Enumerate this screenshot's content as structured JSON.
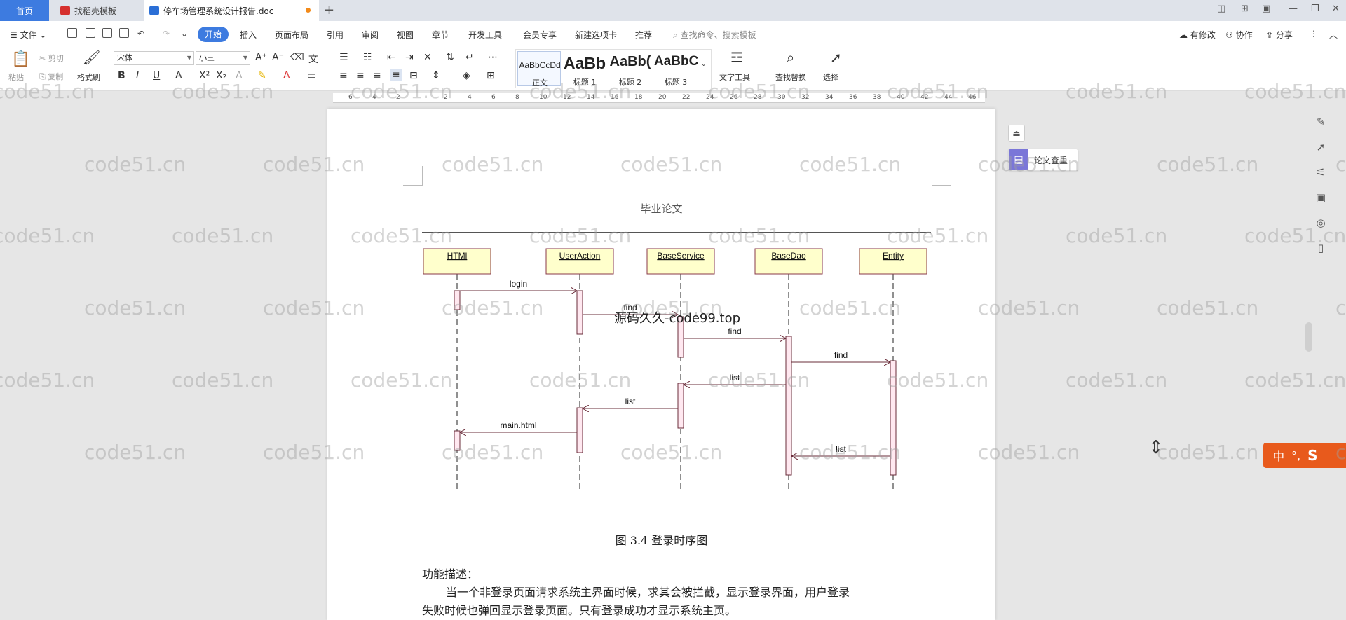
{
  "tabs": {
    "home": "首页",
    "doc1": "找稻壳模板",
    "doc2": "停车场管理系统设计报告.doc"
  },
  "menu": {
    "file": "文件",
    "start": "开始",
    "items": [
      "插入",
      "页面布局",
      "引用",
      "审阅",
      "视图",
      "章节",
      "开发工具",
      "会员专享",
      "新建选项卡",
      "推荐"
    ],
    "search_placeholder": "查找命令、搜索模板",
    "right": [
      "有修改",
      "协作",
      "分享"
    ]
  },
  "ribbon": {
    "paste": "粘贴",
    "cut": "剪切",
    "copy": "复制",
    "format_painter": "格式刷",
    "font_name": "宋体",
    "font_size": "小三",
    "styles": [
      {
        "preview": "AaBbCcDd",
        "name": "正文"
      },
      {
        "preview": "AaBb",
        "name": "标题 1"
      },
      {
        "preview": "AaBb(",
        "name": "标题 2"
      },
      {
        "preview": "AaBbC",
        "name": "标题 3"
      }
    ],
    "text_tools": "文字工具",
    "find_replace": "查找替换",
    "select": "选择"
  },
  "ruler_ticks": [
    "6",
    "4",
    "2",
    "",
    "2",
    "4",
    "6",
    "8",
    "10",
    "12",
    "14",
    "16",
    "18",
    "20",
    "22",
    "24",
    "26",
    "28",
    "30",
    "32",
    "34",
    "36",
    "38",
    "40",
    "42",
    "44",
    "46"
  ],
  "page": {
    "header": "毕业论文",
    "diagram": {
      "lifelines": [
        "HTMl",
        "UserAction",
        "BaseService",
        "BaseDao",
        "Entity"
      ],
      "messages": [
        "login",
        "find",
        "find",
        "find",
        "list",
        "list",
        "main.html",
        "list"
      ]
    },
    "figure_caption": "图  3.4  登录时序图",
    "section_label": "功能描述：",
    "paragraph_line1": "当一个非登录页面请求系统主界面时候，求其会被拦截，显示登录界面，用户登录",
    "paragraph_line2": "失败时候也弹回显示登录页面。只有登录成功才显示系统主页。"
  },
  "side": {
    "paper_check": "论文查重"
  },
  "ime": {
    "mode": "中"
  },
  "watermark": {
    "text": "code51.cn",
    "special": "源码久久-code99.top"
  },
  "colors": {
    "accent": "#3d7be0",
    "lifeline_box": "#ffffcc",
    "activation_box": "#ffe8f0",
    "ime": "#e85a1c"
  }
}
